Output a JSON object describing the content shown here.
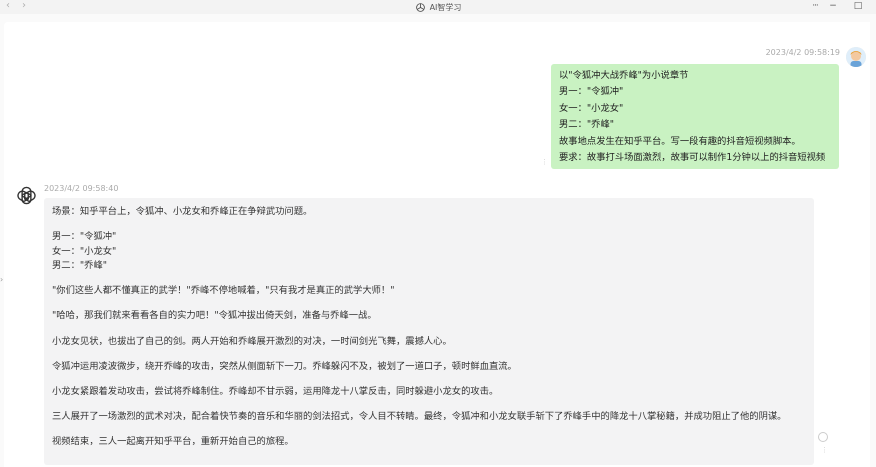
{
  "window": {
    "title": "AI智学习",
    "back_label": "‹",
    "forward_label": "›",
    "menu_label": "···",
    "minimize_label": "−",
    "maximize_label": "□",
    "logo_icon": "openai-logo-icon"
  },
  "conversation": {
    "user_message": {
      "timestamp": "2023/4/2 09:58:19",
      "lines": [
        "以\"令狐冲大战乔峰\"为小说章节",
        "男一：\"令狐冲\"",
        "女一：\"小龙女\"",
        "男二：\"乔峰\"",
        "故事地点发生在知乎平台。写一段有趣的抖音短视频脚本。",
        "要求：故事打斗场面激烈，故事可以制作1分钟以上的抖音短视频"
      ]
    },
    "ai_message": {
      "timestamp": "2023/4/2 09:58:40",
      "intro": "场景：知乎平台上，令狐冲、小龙女和乔峰正在争辩武功问题。",
      "roles": [
        "男一：\"令狐冲\"",
        "女一：\"小龙女\"",
        "男二：\"乔峰\""
      ],
      "paragraphs": [
        "\"你们这些人都不懂真正的武学！\"乔峰不停地喊着，\"只有我才是真正的武学大师！\"",
        "\"哈哈，那我们就来看看各自的实力吧！\"令狐冲拔出倚天剑，准备与乔峰一战。",
        "小龙女见状，也拔出了自己的剑。两人开始和乔峰展开激烈的对决，一时间剑光飞舞，震撼人心。",
        "令狐冲运用凌波微步，绕开乔峰的攻击，突然从侧面斩下一刀。乔峰躲闪不及，被划了一道口子，顿时鲜血直流。",
        "小龙女紧跟着发动攻击，尝试将乔峰制住。乔峰却不甘示弱，运用降龙十八掌反击，同时躲避小龙女的攻击。",
        "三人展开了一场激烈的武术对决，配合着快节奏的音乐和华丽的剑法招式，令人目不转睛。最终，令狐冲和小龙女联手斩下了乔峰手中的降龙十八掌秘籍，并成功阻止了他的阴谋。",
        "视频结束，三人一起离开知乎平台，重新开始自己的旅程。"
      ]
    }
  },
  "colors": {
    "user_bubble": "#c9f2c2",
    "ai_bubble": "#f3f3f4",
    "titlebar": "#f3f3f3"
  }
}
